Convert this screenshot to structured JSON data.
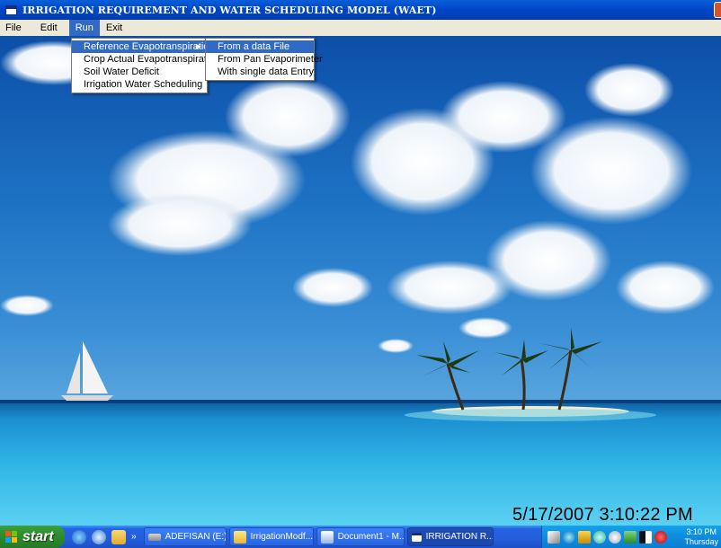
{
  "window": {
    "title": "IRRIGATION REQUIREMENT AND WATER SCHEDULING MODEL (WAET)"
  },
  "menubar": {
    "items": [
      {
        "label": "File"
      },
      {
        "label": "Edit"
      },
      {
        "label": "Run"
      },
      {
        "label": "Exit"
      }
    ],
    "active": "Run"
  },
  "run_menu": {
    "items": [
      {
        "label": "Reference Evapotranspiration",
        "has_submenu": true
      },
      {
        "label": "Crop Actual Evapotranspiration"
      },
      {
        "label": "Soil Water Deficit"
      },
      {
        "label": "Irrigation Water Scheduling"
      }
    ]
  },
  "submenu": {
    "items": [
      {
        "label": "From a data File"
      },
      {
        "label": "From Pan Evaporimeter"
      },
      {
        "label": "With single data Entry"
      }
    ]
  },
  "desktop": {
    "clock_overlay": "5/17/2007 3:10:22 PM"
  },
  "taskbar": {
    "start_label": "start",
    "quick_launch_more": "»",
    "tasks": [
      {
        "label": "ADEFISAN (E:)"
      },
      {
        "label": "IrrigationModf..."
      },
      {
        "label": "Document1 - M..."
      },
      {
        "label": "IRRIGATION R..."
      }
    ],
    "tray_time": "3:10 PM",
    "tray_day": "Thursday"
  },
  "colors": {
    "titlebar": "#0046c8",
    "menu_highlight": "#316ac5",
    "menubar_bg": "#ece9d8",
    "taskbar": "#245edb",
    "start": "#2f8d2f"
  }
}
